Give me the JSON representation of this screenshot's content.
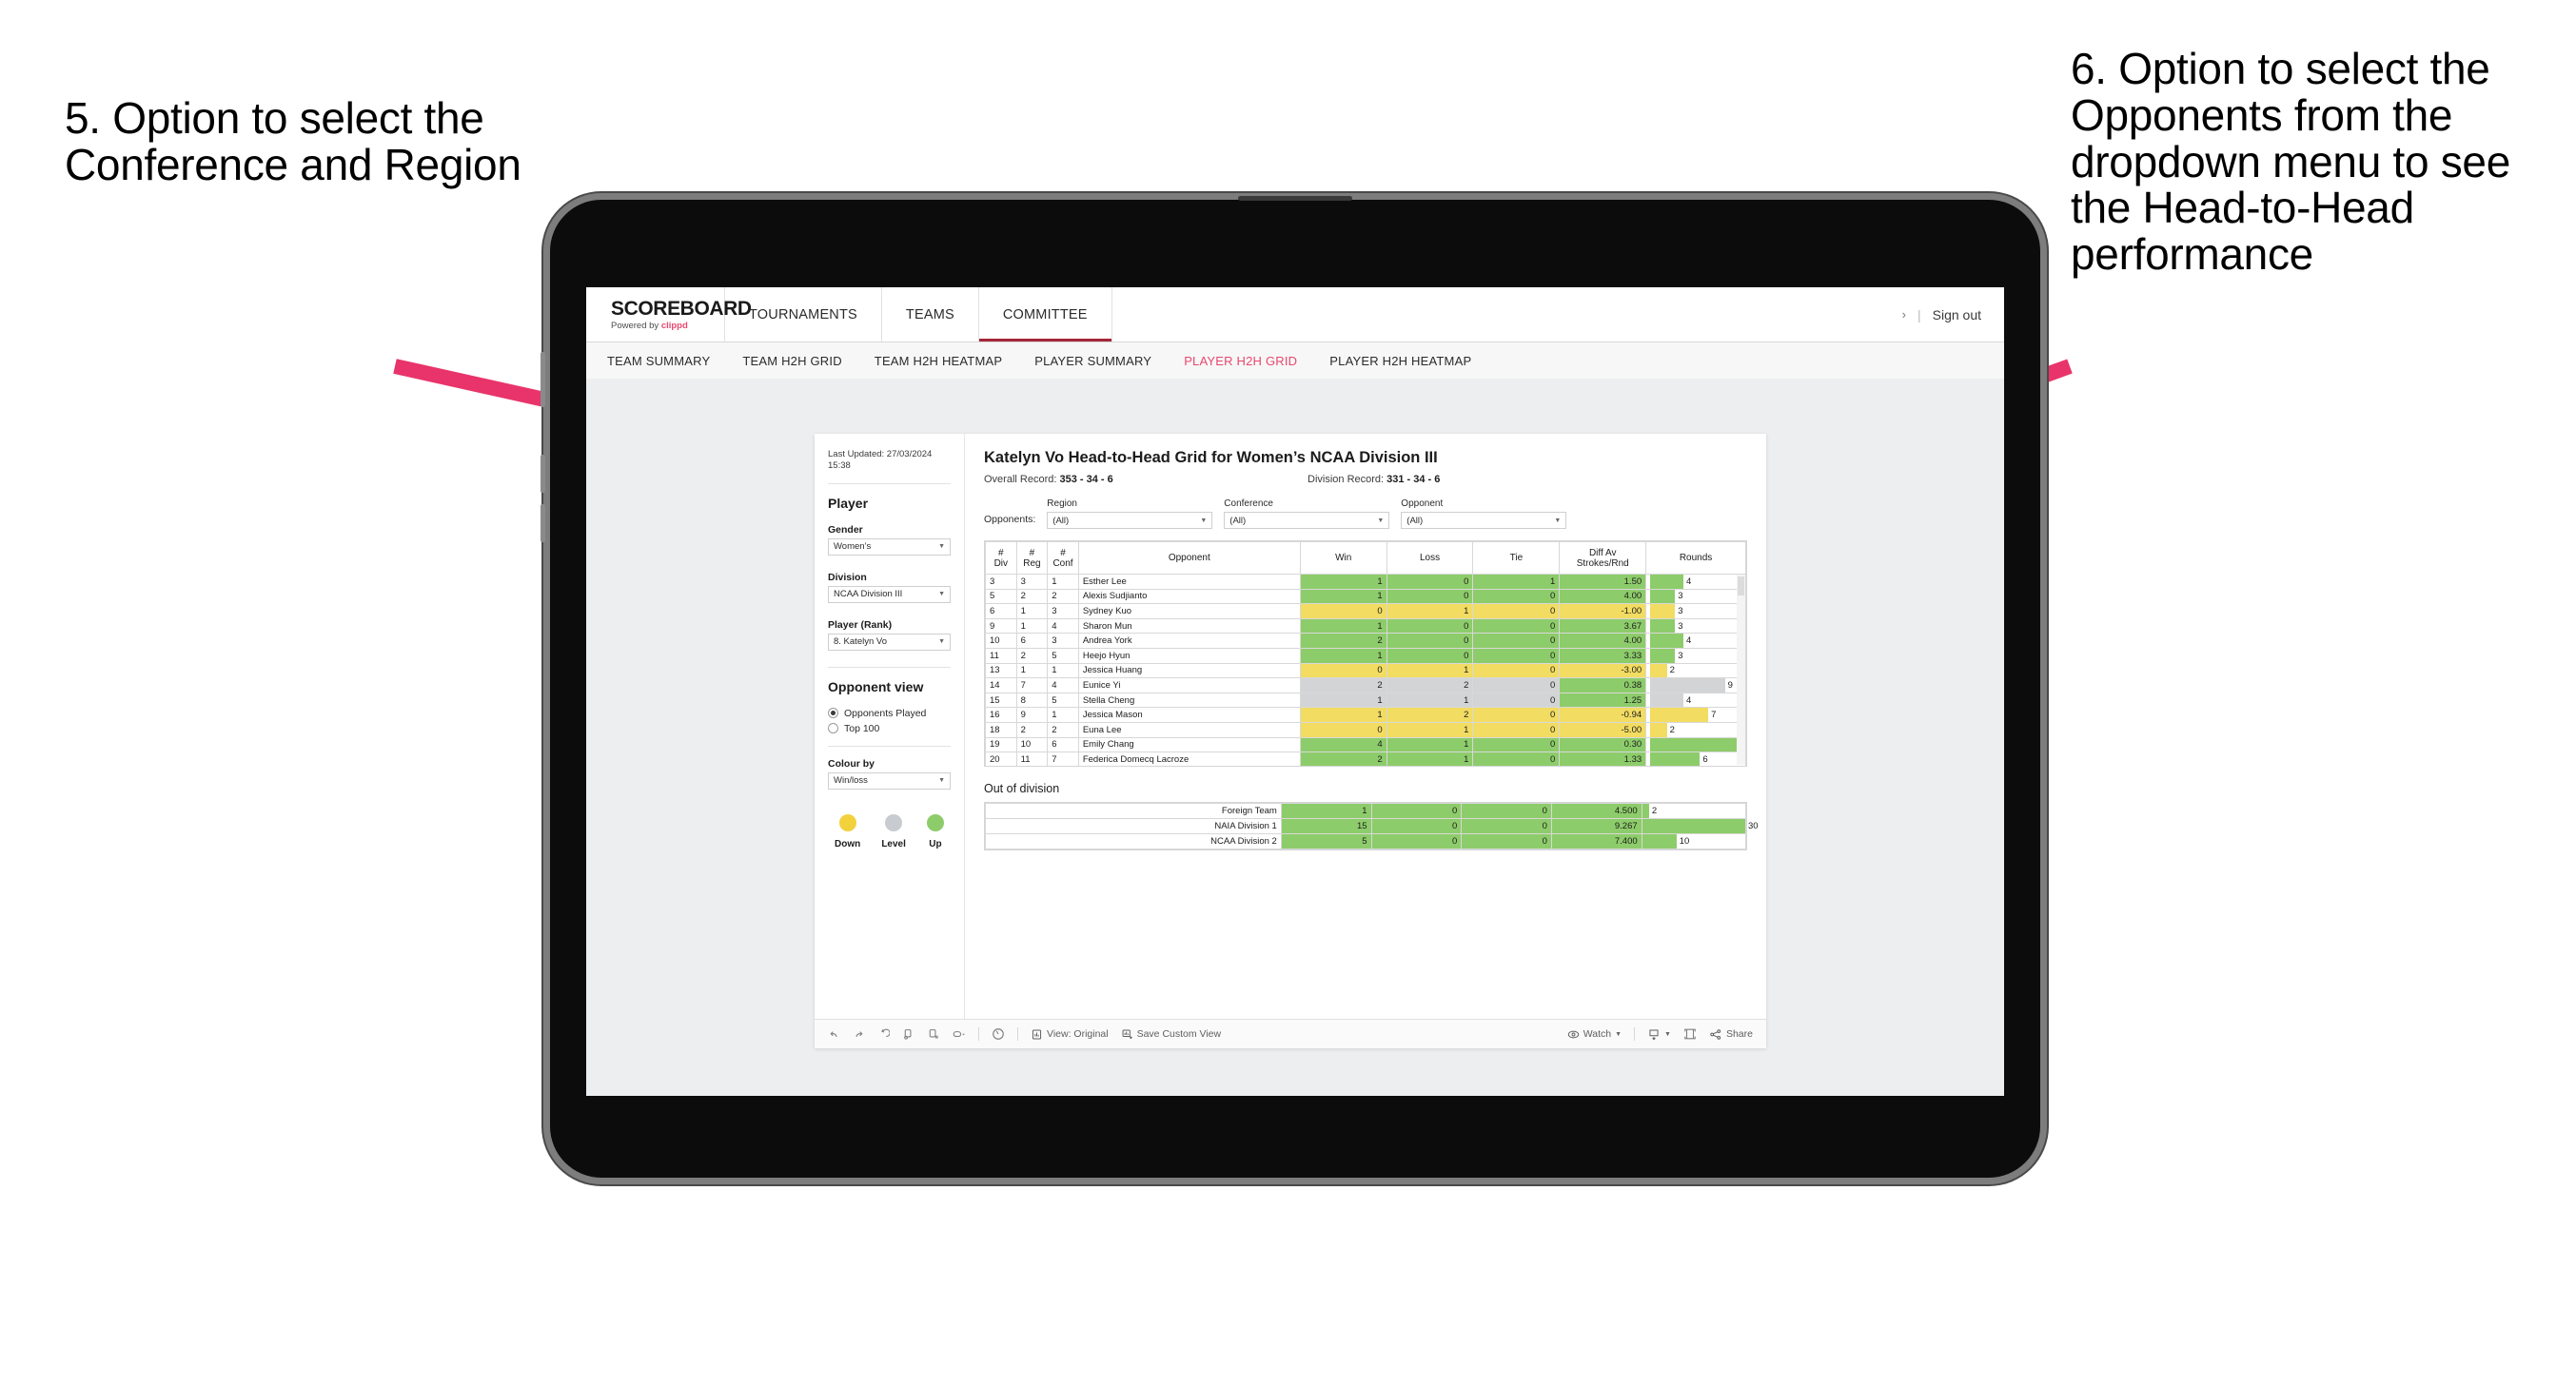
{
  "annotations": {
    "left": "5. Option to select the Conference and Region",
    "right": "6. Option to select the Opponents from the dropdown menu to see the Head-to-Head performance",
    "arrow_color": "#E8346A"
  },
  "app": {
    "brand": {
      "title": "SCOREBOARD",
      "powered_prefix": "Powered by ",
      "powered_name": "clippd"
    },
    "nav": [
      {
        "label": "TOURNAMENTS",
        "active": false
      },
      {
        "label": "TEAMS",
        "active": false
      },
      {
        "label": "COMMITTEE",
        "active": true
      }
    ],
    "nav_right": {
      "chevron": "›",
      "divider": "|",
      "signout": "Sign out"
    },
    "subnav": [
      {
        "label": "TEAM SUMMARY",
        "active": false
      },
      {
        "label": "TEAM H2H GRID",
        "active": false
      },
      {
        "label": "TEAM H2H HEATMAP",
        "active": false
      },
      {
        "label": "PLAYER SUMMARY",
        "active": false
      },
      {
        "label": "PLAYER H2H GRID",
        "active": true
      },
      {
        "label": "PLAYER H2H HEATMAP",
        "active": false
      }
    ]
  },
  "sidebar": {
    "last_updated": "Last Updated: 27/03/2024 15:38",
    "player_heading": "Player",
    "fields": [
      {
        "label": "Gender",
        "value": "Women’s"
      },
      {
        "label": "Division",
        "value": "NCAA Division III"
      },
      {
        "label": "Player (Rank)",
        "value": "8. Katelyn Vo"
      }
    ],
    "opponent_view": {
      "heading": "Opponent view",
      "options": [
        {
          "label": "Opponents Played",
          "checked": true
        },
        {
          "label": "Top 100",
          "checked": false
        }
      ]
    },
    "colour_by": {
      "label": "Colour by",
      "value": "Win/loss"
    },
    "legend": [
      {
        "label": "Down",
        "color": "#F2D13C"
      },
      {
        "label": "Level",
        "color": "#C8CBCF"
      },
      {
        "label": "Up",
        "color": "#8DCC6A"
      }
    ]
  },
  "viz": {
    "title": "Katelyn Vo Head-to-Head Grid for Women’s NCAA Division III",
    "overall_record_label": "Overall Record: ",
    "overall_record_value": "353 - 34 - 6",
    "division_record_label": "Division Record: ",
    "division_record_value": "331 -  34 - 6",
    "opponents_label": "Opponents:",
    "filters": [
      {
        "label": "Region",
        "value": "(All)"
      },
      {
        "label": "Conference",
        "value": "(All)"
      },
      {
        "label": "Opponent",
        "value": "(All)"
      }
    ],
    "out_of_division_title": "Out of division",
    "toolbar": {
      "view_label": "View: Original",
      "save_label": "Save Custom View",
      "watch_label": "Watch",
      "share_label": "Share"
    }
  },
  "chart_data": {
    "type": "table",
    "title": "Katelyn Vo Head-to-Head Grid for Women’s NCAA Division III",
    "columns": [
      "# Div",
      "# Reg",
      "# Conf",
      "Opponent",
      "Win",
      "Loss",
      "Tie",
      "Diff Av Strokes/Rnd",
      "Rounds"
    ],
    "header_lines": [
      [
        "#",
        "Div"
      ],
      [
        "#",
        "Reg"
      ],
      [
        "#",
        "Conf"
      ],
      [
        "Opponent"
      ],
      [
        "Win"
      ],
      [
        "Loss"
      ],
      [
        "Tie"
      ],
      [
        "Diff Av",
        "Strokes/Rnd"
      ],
      [
        "Rounds"
      ]
    ],
    "colors": {
      "up": "#8DCC6A",
      "down": "#F2DC62",
      "level": "#D2D4D6"
    },
    "rounds_max": 11,
    "rows": [
      {
        "div": "3",
        "reg": "3",
        "conf": "1",
        "opponent": "Esther Lee",
        "win": "1",
        "loss": "0",
        "tie": "1",
        "diff": "1.50",
        "rounds": 4,
        "state": "up"
      },
      {
        "div": "5",
        "reg": "2",
        "conf": "2",
        "opponent": "Alexis Sudjianto",
        "win": "1",
        "loss": "0",
        "tie": "0",
        "diff": "4.00",
        "rounds": 3,
        "state": "up"
      },
      {
        "div": "6",
        "reg": "1",
        "conf": "3",
        "opponent": "Sydney Kuo",
        "win": "0",
        "loss": "1",
        "tie": "0",
        "diff": "-1.00",
        "rounds": 3,
        "state": "down"
      },
      {
        "div": "9",
        "reg": "1",
        "conf": "4",
        "opponent": "Sharon Mun",
        "win": "1",
        "loss": "0",
        "tie": "0",
        "diff": "3.67",
        "rounds": 3,
        "state": "up"
      },
      {
        "div": "10",
        "reg": "6",
        "conf": "3",
        "opponent": "Andrea York",
        "win": "2",
        "loss": "0",
        "tie": "0",
        "diff": "4.00",
        "rounds": 4,
        "state": "up"
      },
      {
        "div": "11",
        "reg": "2",
        "conf": "5",
        "opponent": "Heejo Hyun",
        "win": "1",
        "loss": "0",
        "tie": "0",
        "diff": "3.33",
        "rounds": 3,
        "state": "up"
      },
      {
        "div": "13",
        "reg": "1",
        "conf": "1",
        "opponent": "Jessica Huang",
        "win": "0",
        "loss": "1",
        "tie": "0",
        "diff": "-3.00",
        "rounds": 2,
        "state": "down"
      },
      {
        "div": "14",
        "reg": "7",
        "conf": "4",
        "opponent": "Eunice Yi",
        "win": "2",
        "loss": "2",
        "tie": "0",
        "diff": "0.38",
        "rounds": 9,
        "state": "level",
        "diff_state": "up"
      },
      {
        "div": "15",
        "reg": "8",
        "conf": "5",
        "opponent": "Stella Cheng",
        "win": "1",
        "loss": "1",
        "tie": "0",
        "diff": "1.25",
        "rounds": 4,
        "state": "level",
        "diff_state": "up"
      },
      {
        "div": "16",
        "reg": "9",
        "conf": "1",
        "opponent": "Jessica Mason",
        "win": "1",
        "loss": "2",
        "tie": "0",
        "diff": "-0.94",
        "rounds": 7,
        "state": "down"
      },
      {
        "div": "18",
        "reg": "2",
        "conf": "2",
        "opponent": "Euna Lee",
        "win": "0",
        "loss": "1",
        "tie": "0",
        "diff": "-5.00",
        "rounds": 2,
        "state": "down"
      },
      {
        "div": "19",
        "reg": "10",
        "conf": "6",
        "opponent": "Emily Chang",
        "win": "4",
        "loss": "1",
        "tie": "0",
        "diff": "0.30",
        "rounds": 11,
        "state": "up"
      },
      {
        "div": "20",
        "reg": "11",
        "conf": "7",
        "opponent": "Federica Domecq Lacroze",
        "win": "2",
        "loss": "1",
        "tie": "0",
        "diff": "1.33",
        "rounds": 6,
        "state": "up"
      }
    ],
    "out_of_division": {
      "rounds_max": 30,
      "rows": [
        {
          "name": "Foreign Team",
          "win": "1",
          "loss": "0",
          "tie": "0",
          "diff": "4.500",
          "rounds": 2,
          "state": "up"
        },
        {
          "name": "NAIA Division 1",
          "win": "15",
          "loss": "0",
          "tie": "0",
          "diff": "9.267",
          "rounds": 30,
          "state": "up"
        },
        {
          "name": "NCAA Division 2",
          "win": "5",
          "loss": "0",
          "tie": "0",
          "diff": "7.400",
          "rounds": 10,
          "state": "up"
        }
      ]
    }
  }
}
